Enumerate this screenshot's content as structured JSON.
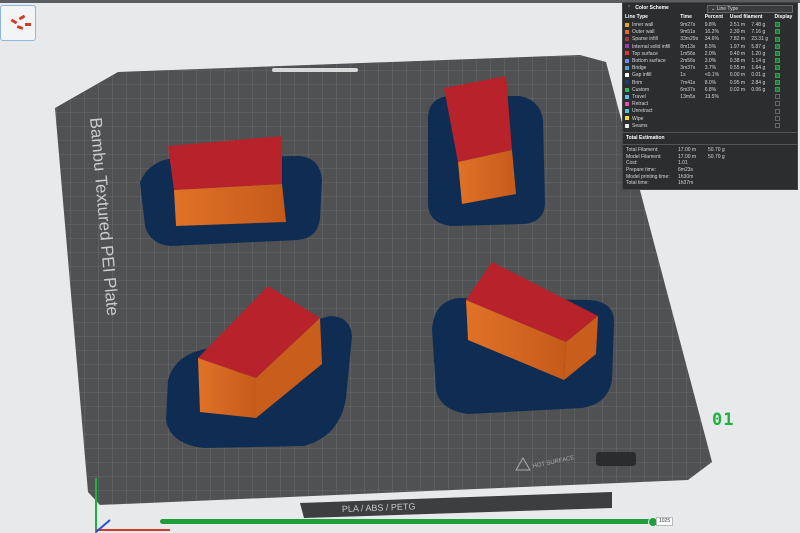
{
  "legend": {
    "title": "Color Scheme",
    "selected_scheme": "Line Type",
    "columns": [
      "Line Type",
      "Time",
      "Percent",
      "Used filament",
      "Display"
    ],
    "rows": [
      {
        "name": "Inner wall",
        "color": "#e8a32a",
        "time": "9m27s",
        "percent": "9.8%",
        "length": "2.51 m",
        "weight": "7.48 g",
        "display": true
      },
      {
        "name": "Outer wall",
        "color": "#e86a1c",
        "time": "9m51s",
        "percent": "10.2%",
        "length": "2.39 m",
        "weight": "7.16 g",
        "display": true
      },
      {
        "name": "Sparse infill",
        "color": "#a8324a",
        "time": "33m29s",
        "percent": "34.6%",
        "length": "7.82 m",
        "weight": "23.31 g",
        "display": true
      },
      {
        "name": "Internal solid infill",
        "color": "#9a3cb4",
        "time": "8m13s",
        "percent": "8.5%",
        "length": "1.97 m",
        "weight": "5.87 g",
        "display": true
      },
      {
        "name": "Top surface",
        "color": "#e8303a",
        "time": "1m56s",
        "percent": "2.0%",
        "length": "0.40 m",
        "weight": "1.20 g",
        "display": true
      },
      {
        "name": "Bottom surface",
        "color": "#6c8be8",
        "time": "2m56s",
        "percent": "3.0%",
        "length": "0.38 m",
        "weight": "1.14 g",
        "display": true
      },
      {
        "name": "Bridge",
        "color": "#5a9bd0",
        "time": "3m37s",
        "percent": "3.7%",
        "length": "0.55 m",
        "weight": "1.64 g",
        "display": true
      },
      {
        "name": "Gap infill",
        "color": "#ffffff",
        "time": "1s",
        "percent": "<0.1%",
        "length": "0.00 m",
        "weight": "0.01 g",
        "display": true
      },
      {
        "name": "Brim",
        "color": "#1e3a6e",
        "time": "7m41s",
        "percent": "8.0%",
        "length": "0.95 m",
        "weight": "2.84 g",
        "display": true
      },
      {
        "name": "Custom",
        "color": "#2fb86a",
        "time": "6m37s",
        "percent": "6.8%",
        "length": "0.02 m",
        "weight": "0.06 g",
        "display": true
      },
      {
        "name": "Travel",
        "color": "#58c0e8",
        "time": "13m5s",
        "percent": "13.5%",
        "length": "",
        "weight": "",
        "display": false
      },
      {
        "name": "Retract",
        "color": "#e84ab8",
        "time": "",
        "percent": "",
        "length": "",
        "weight": "",
        "display": false
      },
      {
        "name": "Unretract",
        "color": "#46c8d8",
        "time": "",
        "percent": "",
        "length": "",
        "weight": "",
        "display": false
      },
      {
        "name": "Wipe",
        "color": "#f0e030",
        "time": "",
        "percent": "",
        "length": "",
        "weight": "",
        "display": false
      },
      {
        "name": "Seams",
        "color": "#e8e8e8",
        "time": "",
        "percent": "",
        "length": "",
        "weight": "",
        "display": false
      }
    ],
    "estimation": {
      "title": "Total Estimation",
      "rows": [
        {
          "label": "Total Filament:",
          "v1": "17.00 m",
          "v2": "50.70 g"
        },
        {
          "label": "Model Filament:",
          "v1": "17.00 m",
          "v2": "50.70 g"
        },
        {
          "label": "Cost:",
          "v1": "1.01",
          "v2": ""
        },
        {
          "label": "Prepare time:",
          "v1": "6m23s",
          "v2": ""
        },
        {
          "label": "Model printing time:",
          "v1": "1h30m",
          "v2": ""
        },
        {
          "label": "Total time:",
          "v1": "1h37m",
          "v2": ""
        }
      ]
    }
  },
  "plate": {
    "label": "Bambu Textured PEI Plate",
    "material_label": "PLA / ABS / PETG",
    "warning_label": "HOT SURFACE",
    "plate_number": "01"
  },
  "layer_slider": {
    "value": "1025",
    "progress": 1.0
  },
  "colors": {
    "plate": "#5a5c5e",
    "grid": "#7a7d80",
    "brim": "#0f2d52",
    "wall": "#d9661f",
    "top": "#b8222a",
    "accent": "#1f9e3c"
  }
}
